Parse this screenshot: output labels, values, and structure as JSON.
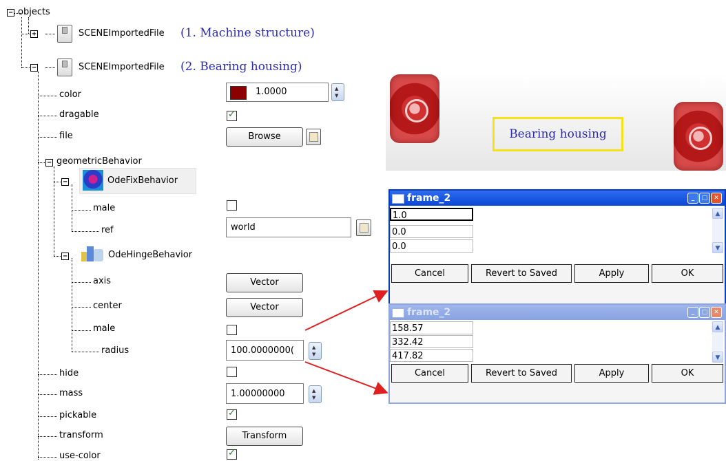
{
  "tree": {
    "root_label": "objects",
    "objects": [
      {
        "label": "SCENEImportedFile",
        "caption": "(1. Machine structure)",
        "expanded": false
      },
      {
        "label": "SCENEImportedFile",
        "caption": "(2. Bearing housing)",
        "expanded": true
      }
    ],
    "properties": {
      "color": {
        "label": "color",
        "value": "1.0000",
        "swatch": "#8b0000"
      },
      "dragable": {
        "label": "dragable",
        "checked": true
      },
      "file": {
        "label": "file",
        "button": "Browse"
      },
      "geometricBehavior": {
        "label": "geometricBehavior"
      },
      "odefix": {
        "label": "OdeFixBehavior",
        "male": {
          "label": "male",
          "checked": false
        },
        "ref": {
          "label": "ref",
          "value": "world"
        }
      },
      "odehinge": {
        "label": "OdeHingeBehavior",
        "axis": {
          "label": "axis",
          "button": "Vector"
        },
        "center": {
          "label": "center",
          "button": "Vector"
        },
        "male": {
          "label": "male",
          "checked": false
        },
        "radius": {
          "label": "radius",
          "value": "100.0000000("
        }
      },
      "hide": {
        "label": "hide",
        "checked": false
      },
      "mass": {
        "label": "mass",
        "value": "1.00000000"
      },
      "pickable": {
        "label": "pickable",
        "checked": true
      },
      "transform": {
        "label": "transform",
        "button": "Transform"
      },
      "usecolor": {
        "label": "use-color",
        "checked": true
      }
    }
  },
  "preview": {
    "caption": "Bearing housing",
    "caption_border": "#f5e21a"
  },
  "frames": [
    {
      "title": "frame_2",
      "active": true,
      "cells": [
        "1.0",
        "0.0",
        "0.0"
      ],
      "buttons": [
        "Cancel",
        "Revert to Saved",
        "Apply",
        "OK"
      ]
    },
    {
      "title": "frame_2",
      "active": false,
      "cells": [
        "158.57",
        "332.42",
        "417.82"
      ],
      "buttons": [
        "Cancel",
        "Revert to Saved",
        "Apply",
        "OK"
      ]
    }
  ],
  "colors": {
    "arrow": "#e02020",
    "link_blue": "#2b2bb0",
    "title_blue": "#0a47d4"
  }
}
